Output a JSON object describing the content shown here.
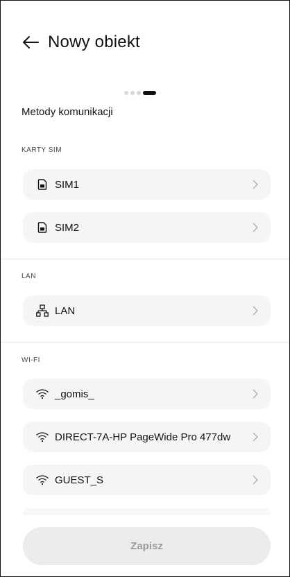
{
  "header": {
    "title": "Nowy obiekt",
    "back_icon": "arrow-left-icon"
  },
  "stepper": {
    "total": 4,
    "current": 4
  },
  "main": {
    "section_title": "Metody komunikacji",
    "groups": {
      "sim": {
        "label": "KARTY SIM",
        "items": [
          {
            "label": "SIM1",
            "icon": "sim-card-icon"
          },
          {
            "label": "SIM2",
            "icon": "sim-card-icon"
          }
        ]
      },
      "lan": {
        "label": "LAN",
        "items": [
          {
            "label": "LAN",
            "icon": "network-icon"
          }
        ]
      },
      "wifi": {
        "label": "WI-FI",
        "items": [
          {
            "label": "_gomis_",
            "icon": "wifi-icon"
          },
          {
            "label": "DIRECT-7A-HP PageWide Pro 477dw",
            "icon": "wifi-icon"
          },
          {
            "label": "GUEST_S",
            "icon": "wifi-icon"
          }
        ]
      }
    }
  },
  "footer": {
    "save_label": "Zapisz"
  },
  "colors": {
    "item_bg": "#f5f5f5",
    "button_bg": "#ececec",
    "button_text": "#9a9a9a",
    "dot_active": "#111111",
    "dot_inactive": "#d7d7d7"
  }
}
